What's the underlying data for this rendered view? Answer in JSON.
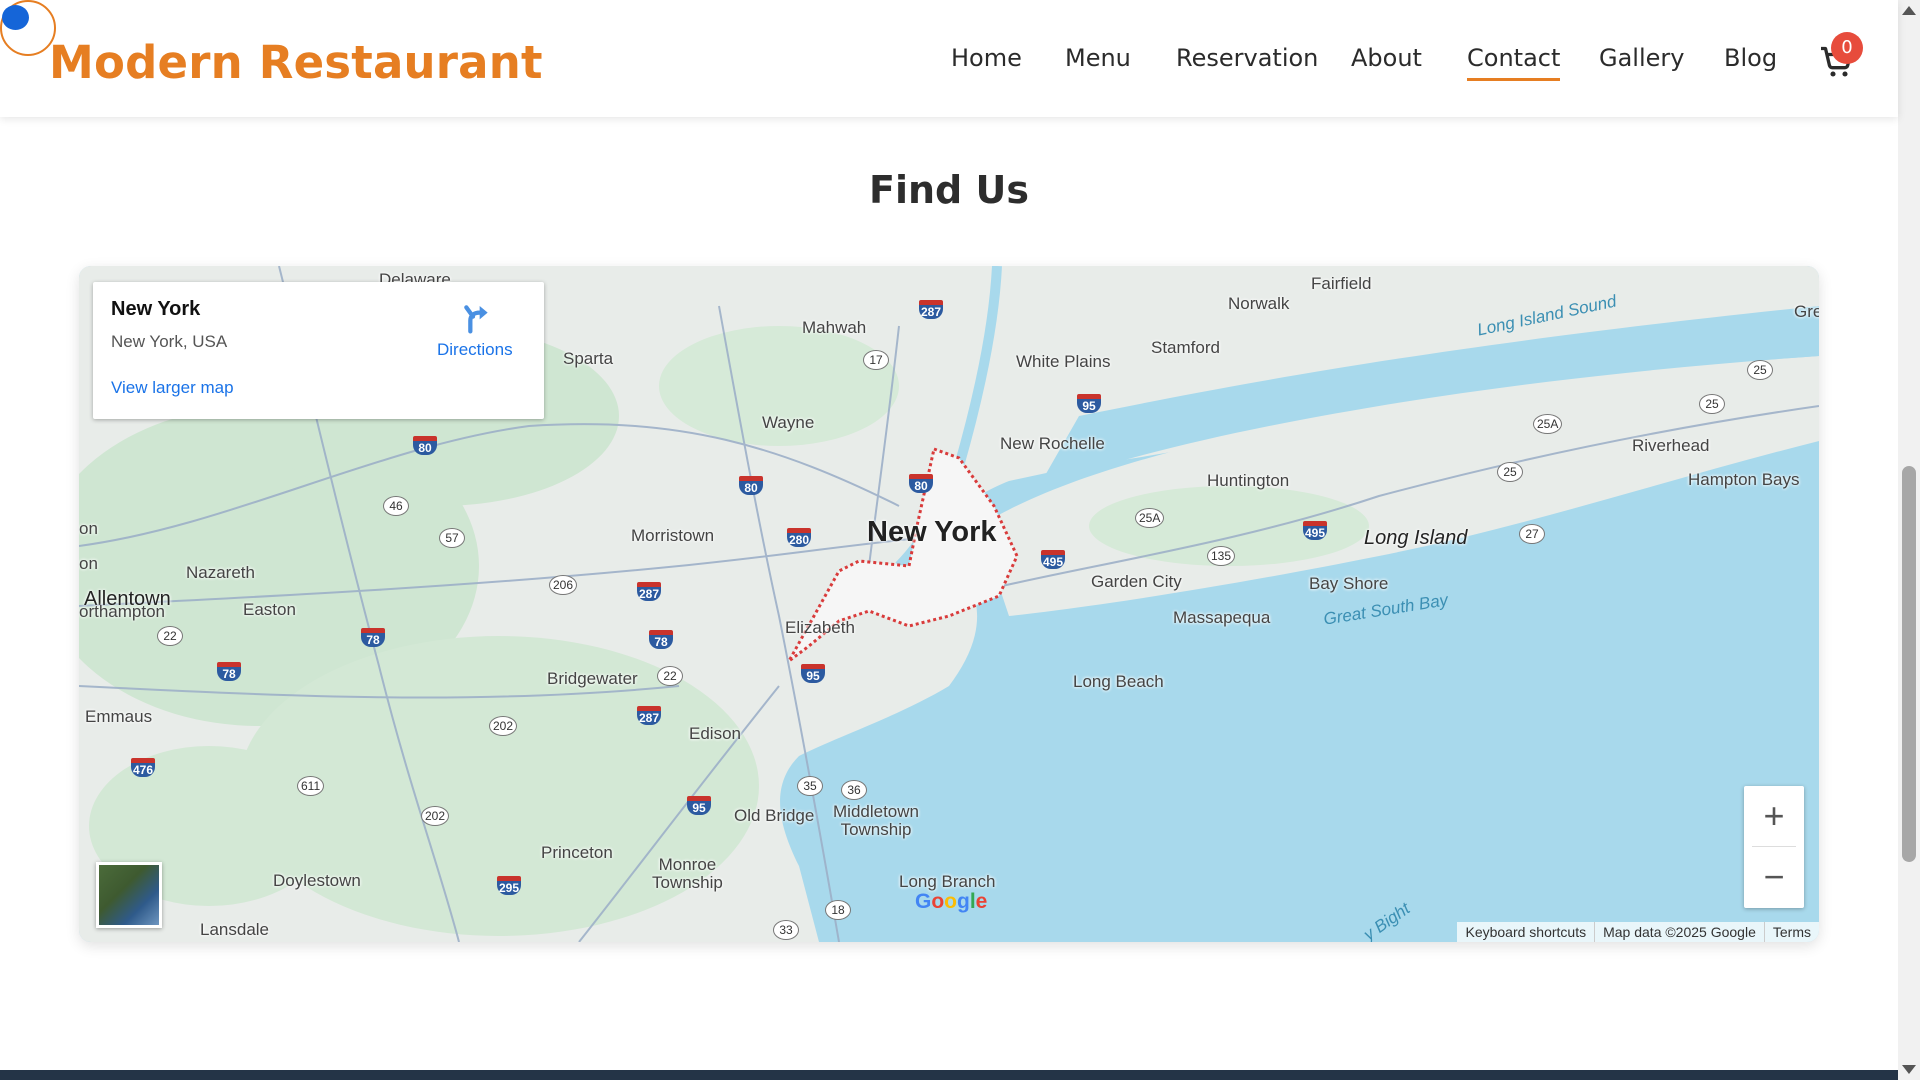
{
  "header": {
    "logo": "Modern Restaurant",
    "nav": [
      "Home",
      "Menu",
      "Reservation",
      "About",
      "Contact",
      "Gallery",
      "Blog"
    ],
    "active_nav": "Contact",
    "cart_count": "0",
    "accent_color": "#e67e22"
  },
  "main": {
    "section_title": "Find Us"
  },
  "map": {
    "info_card": {
      "title": "New York",
      "address": "New York, USA",
      "directions_label": "Directions",
      "larger_map_link": "View larger map"
    },
    "labels": {
      "new_york": "New York",
      "allentown": "Allentown",
      "long_island": "Long Island",
      "mahwah": "Mahwah",
      "sparta": "Sparta",
      "wayne": "Wayne",
      "white_plains": "White Plains",
      "stamford": "Stamford",
      "norwalk": "Norwalk",
      "fairfield": "Fairfield",
      "new_rochelle": "New Rochelle",
      "huntington": "Huntington",
      "riverhead": "Riverhead",
      "hampton_bays": "Hampton Bays",
      "morristown": "Morristown",
      "nazareth": "Nazareth",
      "easton": "Easton",
      "northampton": "orthampton",
      "emmaus": "Emmaus",
      "elizabeth": "Elizabeth",
      "bridgewater": "Bridgewater",
      "edison": "Edison",
      "garden_city": "Garden City",
      "massapequa": "Massapequa",
      "bay_shore": "Bay Shore",
      "long_beach": "Long Beach",
      "old_bridge": "Old Bridge",
      "middletown": "Middletown\nTownship",
      "princeton": "Princeton",
      "monroe": "Monroe\nTownship",
      "doylestown": "Doylestown",
      "lansdale": "Lansdale",
      "long_branch": "Long Branch",
      "delaware": "Delaware",
      "on1": "on",
      "on2": "on",
      "gre": "Gre",
      "long_island_sound": "Long Island Sound",
      "great_south_bay": "Great South Bay",
      "bight": "y Bight"
    },
    "interstates": [
      "287",
      "80",
      "80",
      "80",
      "280",
      "287",
      "78",
      "78",
      "78",
      "95",
      "287",
      "295",
      "495",
      "95",
      "495",
      "95",
      "476"
    ],
    "routes": [
      "17",
      "46",
      "57",
      "206",
      "22",
      "202",
      "202",
      "611",
      "35",
      "36",
      "18",
      "33",
      "22",
      "25A",
      "135",
      "25",
      "25A",
      "25",
      "27",
      "25"
    ],
    "zoom_in": "+",
    "zoom_out": "−",
    "google_logo": "Google",
    "attribution": [
      "Keyboard shortcuts",
      "Map data ©2025 Google",
      "Terms"
    ]
  }
}
